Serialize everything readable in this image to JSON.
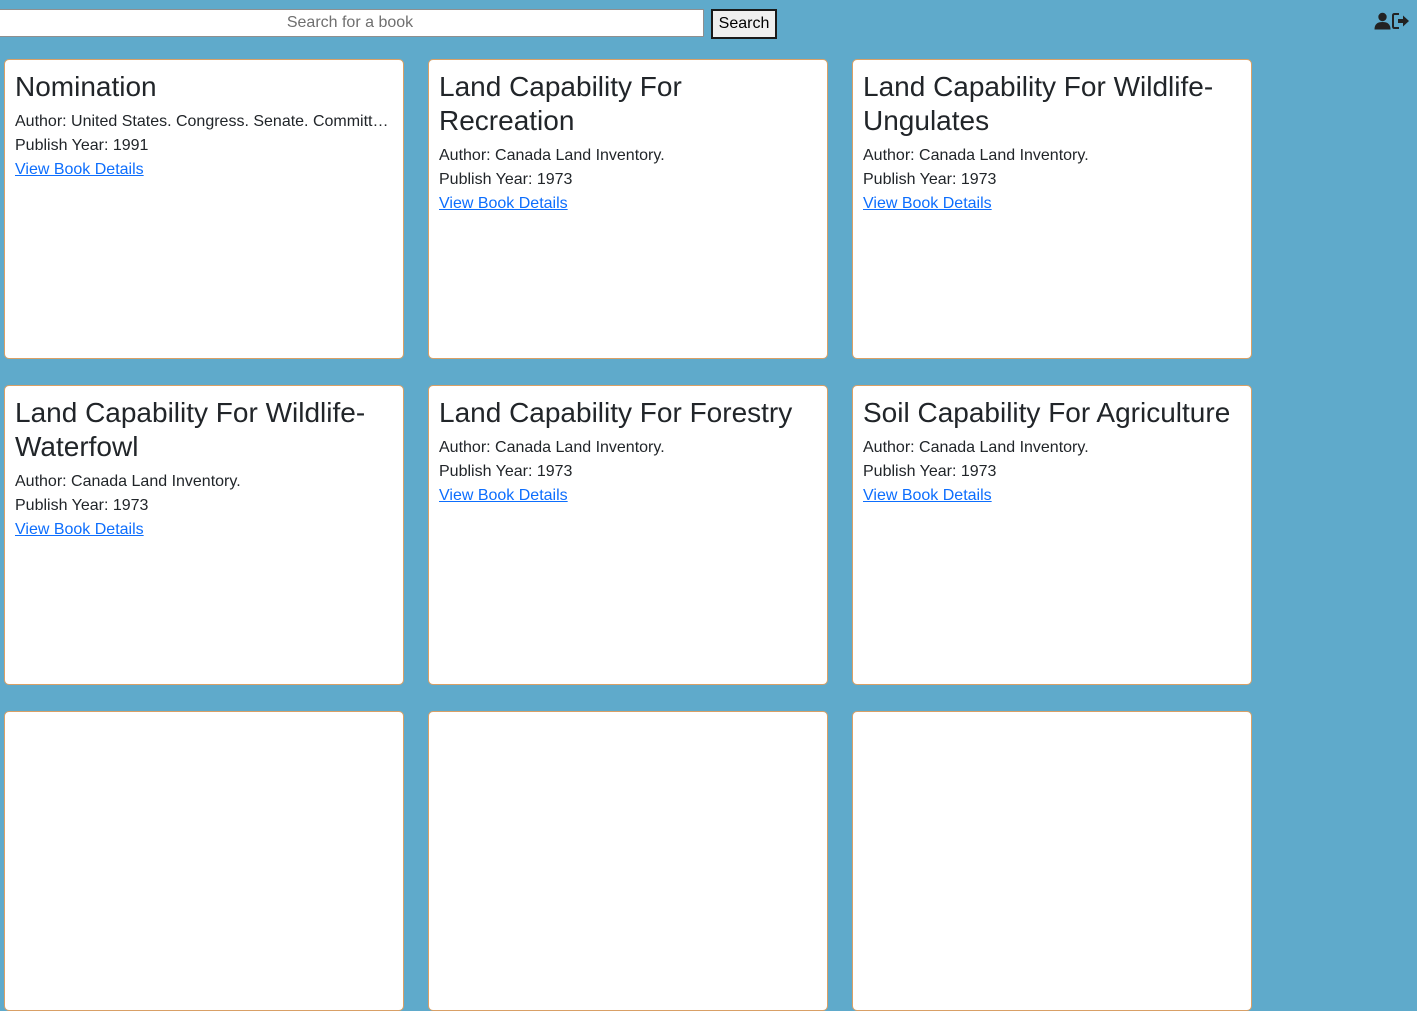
{
  "search": {
    "placeholder": "Search for a book",
    "value": "",
    "button_label": "Search"
  },
  "header_icons": [
    "user-icon",
    "logout-icon"
  ],
  "labels": {
    "author_prefix": "Author: ",
    "year_prefix": "Publish Year: ",
    "details_link": "View Book Details"
  },
  "books": [
    {
      "title": "Nomination",
      "author": "Author: United States. Congress. Senate. Committee on the Judiciary.",
      "year": "Publish Year: 1991",
      "link": "View Book Details"
    },
    {
      "title": "Land Capability For Recreation",
      "author": "Author: Canada Land Inventory.",
      "year": "Publish Year: 1973",
      "link": "View Book Details"
    },
    {
      "title": "Land Capability For Wildlife-Ungulates",
      "author": "Author: Canada Land Inventory.",
      "year": "Publish Year: 1973",
      "link": "View Book Details"
    },
    {
      "title": "Land Capability For Wildlife-Waterfowl",
      "author": "Author: Canada Land Inventory.",
      "year": "Publish Year: 1973",
      "link": "View Book Details"
    },
    {
      "title": "Land Capability For Forestry",
      "author": "Author: Canada Land Inventory.",
      "year": "Publish Year: 1973",
      "link": "View Book Details"
    },
    {
      "title": "Soil Capability For Agriculture",
      "author": "Author: Canada Land Inventory.",
      "year": "Publish Year: 1973",
      "link": "View Book Details"
    },
    {
      "title": "",
      "author": "",
      "year": "",
      "link": ""
    },
    {
      "title": "",
      "author": "",
      "year": "",
      "link": ""
    },
    {
      "title": "",
      "author": "",
      "year": "",
      "link": ""
    }
  ],
  "colors": {
    "background": "#5faacb",
    "card_border": "#d9a066",
    "link": "#0d6efd"
  }
}
